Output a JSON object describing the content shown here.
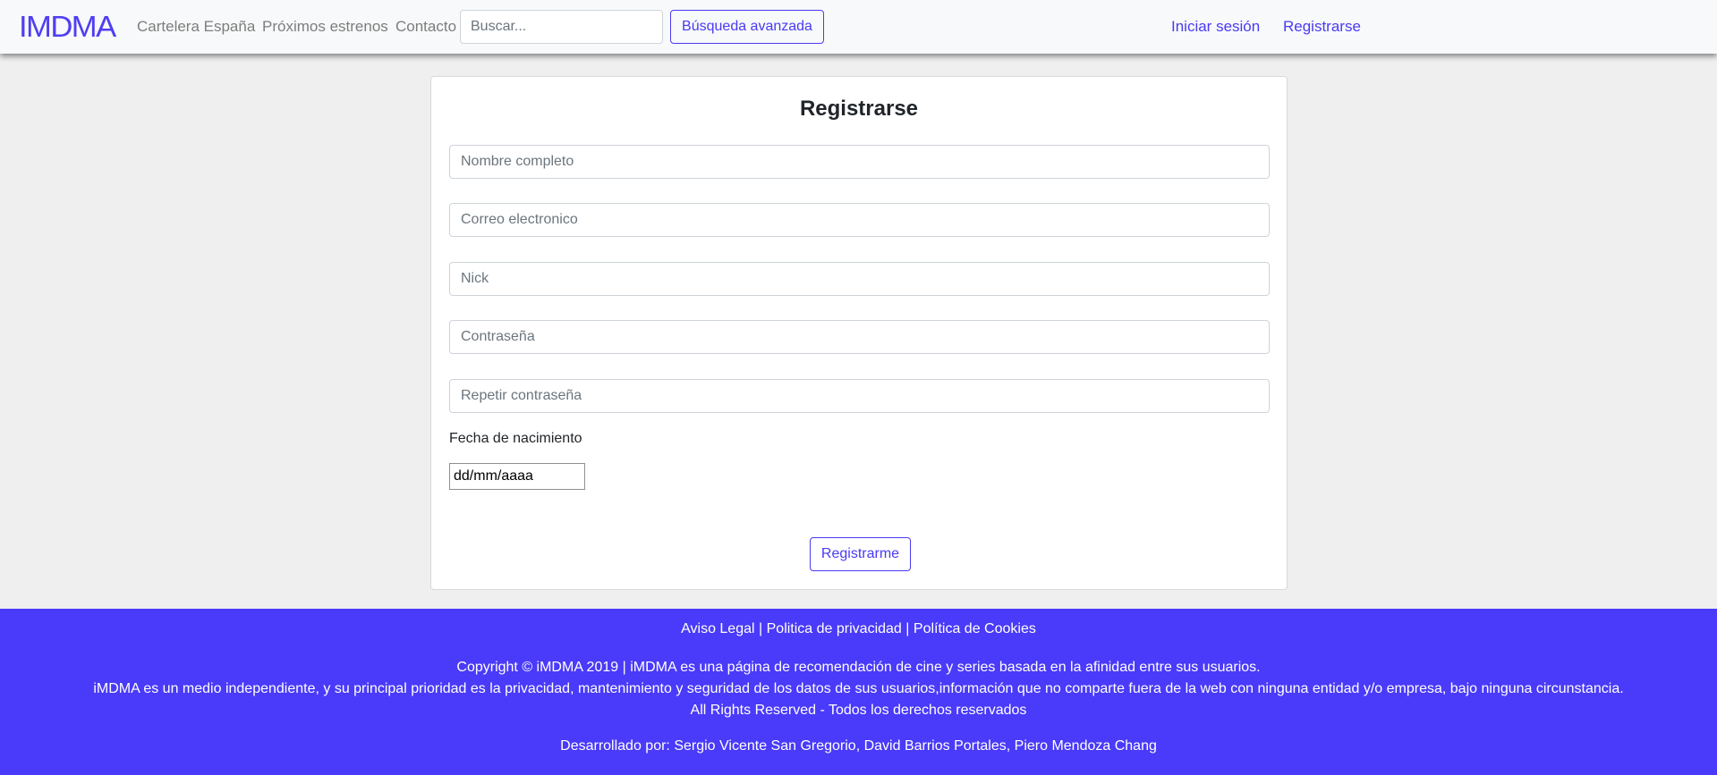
{
  "nav": {
    "logo": "IMDMA",
    "links": [
      "Cartelera España",
      "Próximos estrenos",
      "Contacto"
    ],
    "search_placeholder": "Buscar...",
    "advanced_search": "Búsqueda avanzada",
    "login": "Iniciar sesión",
    "register": "Registrarse"
  },
  "form": {
    "title": "Registrarse",
    "fields": [
      {
        "placeholder": "Nombre completo"
      },
      {
        "placeholder": "Correo electronico"
      },
      {
        "placeholder": "Nick"
      },
      {
        "placeholder": "Contraseña"
      },
      {
        "placeholder": "Repetir contraseña"
      }
    ],
    "dob_label": "Fecha de nacimiento",
    "dob_value": "dd/mm/aaaa",
    "submit": "Registrarme"
  },
  "footer": {
    "links": [
      "Aviso Legal",
      "Politica de privacidad",
      "Política de Cookies"
    ],
    "separator": "|",
    "copyright": "Copyright © iMDMA 2019 | iMDMA es una página de recomendación de cine y series basada en la afinidad entre sus usuarios.",
    "privacy_note": "iMDMA es un medio independiente, y su principal prioridad es la privacidad, mantenimiento y seguridad de los datos de sus usuarios,información que no comparte fuera de la web con ninguna entidad y/o empresa, bajo ninguna circunstancia.",
    "rights": "All Rights Reserved - Todos los derechos reservados",
    "developers": "Desarrollado por: Sergio Vicente San Gregorio, David Barrios Portales, Piero Mendoza Chang"
  },
  "colors": {
    "accent": "#4a3af3",
    "footer_bg": "#4a3af9",
    "navbar_bg": "#f8f9fa",
    "page_bg": "#efefef"
  }
}
